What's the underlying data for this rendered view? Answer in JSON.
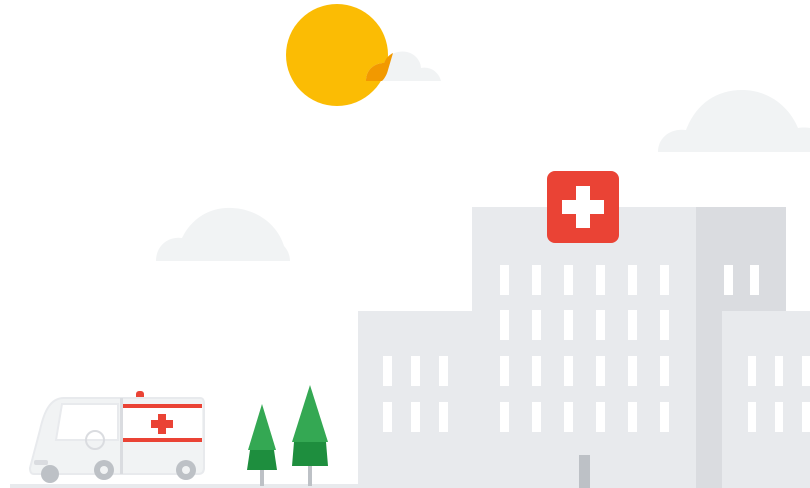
{
  "scene": {
    "type": "illustration",
    "subject": "hospital-with-ambulance",
    "icons": [
      "sun-icon",
      "cloud-icon",
      "hospital-building-icon",
      "medical-cross-icon",
      "ambulance-icon",
      "tree-icon"
    ]
  },
  "colors": {
    "sun": "#FBBC04",
    "sun_shade": "#F9AB00",
    "sun_overlap": "#F29900",
    "cloud": "#F1F3F4",
    "cloud_stroke": "#E8EAED",
    "building_light": "#E8EAED",
    "building_mid": "#DADCE0",
    "window": "#FFFFFF",
    "cross_bg": "#EA4335",
    "cross": "#FFFFFF",
    "ambulance_body": "#F1F3F4",
    "ambulance_stripe": "#EA4335",
    "tire": "#BDC1C6",
    "tree_light": "#34A853",
    "tree_dark": "#1E8E3E",
    "trunk": "#BDC1C6",
    "ground": "#E8EAED"
  }
}
